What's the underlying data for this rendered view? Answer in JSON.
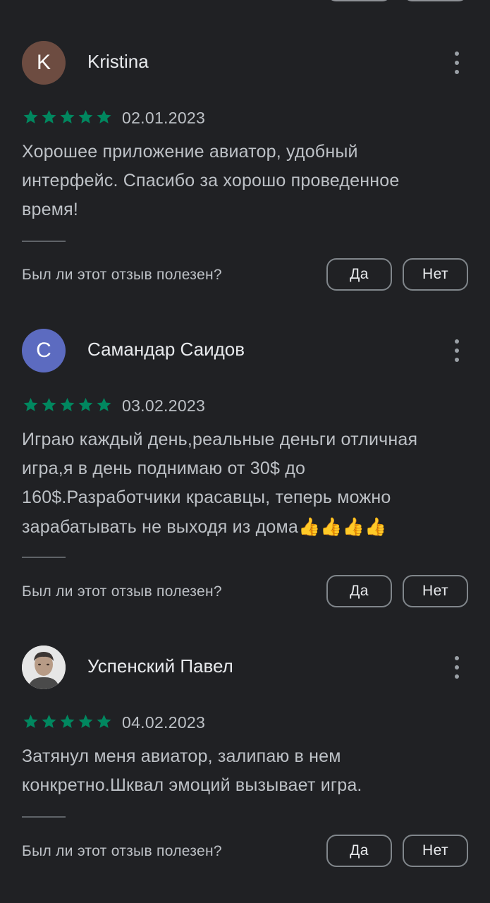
{
  "colors": {
    "background": "#202124",
    "star": "#01875f",
    "avatar_k": "#6d4c41",
    "avatar_c": "#5c6bc0"
  },
  "top_buttons": {
    "yes_label": "",
    "no_label": ""
  },
  "reviews": [
    {
      "author": "Kristina",
      "avatar_letter": "K",
      "rating": 5,
      "date": "02.01.2023",
      "text": "Хорошее приложение авиатор, удобный интерфейс. Спасибо за хорошо проведенное время!",
      "helpful_question": "Был ли этот отзыв полезен?",
      "yes_label": "Да",
      "no_label": "Нет"
    },
    {
      "author": "Самандар Саидов",
      "avatar_letter": "C",
      "rating": 5,
      "date": "03.02.2023",
      "text": "Играю каждый день,реальные деньги отличная игра,я в день поднимаю от 30$ до 160$.Разработчики красавцы, теперь можно зарабатывать не выходя из дома",
      "emoji": "👍👍👍👍",
      "helpful_question": "Был ли этот отзыв полезен?",
      "yes_label": "Да",
      "no_label": "Нет"
    },
    {
      "author": "Успенский Павел",
      "avatar_letter": "",
      "rating": 5,
      "date": "04.02.2023",
      "text": "Затянул меня авиатор, залипаю в нем конкретно.Шквал эмоций вызывает игра.",
      "helpful_question": "Был ли этот отзыв полезен?",
      "yes_label": "Да",
      "no_label": "Нет"
    }
  ],
  "icons": {
    "more": "more-vert-icon",
    "star": "star-icon"
  }
}
